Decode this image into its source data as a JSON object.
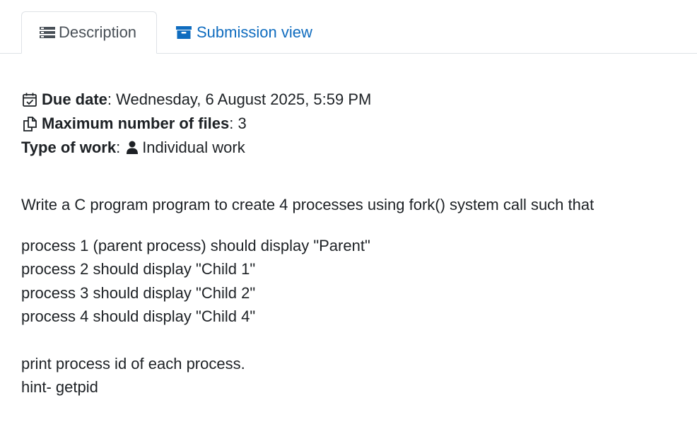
{
  "tabs": [
    {
      "label": "Description",
      "icon": "list-icon",
      "active": true
    },
    {
      "label": "Submission view",
      "icon": "archive-icon",
      "active": false
    }
  ],
  "details": {
    "due_label": "Due date",
    "due_value": "Wednesday, 6 August 2025, 5:59 PM",
    "maxfiles_label": "Maximum number of files",
    "maxfiles_value": "3",
    "worktype_label": "Type of work",
    "worktype_value": "Individual work"
  },
  "description": {
    "intro": "Write a C program program to create 4 processes using fork() system call such that",
    "lines": [
      "process 1 (parent process) should display \"Parent\"",
      "process 2 should display \"Child 1\"",
      "process 3 should display \"Child 2\"",
      "process 4 should display \"Child 4\""
    ],
    "footer": [
      "print process id of each process.",
      "hint- getpid"
    ]
  },
  "colors": {
    "link": "#0f6cbf",
    "text": "#1d2125",
    "tab_border": "#dee2e6"
  }
}
